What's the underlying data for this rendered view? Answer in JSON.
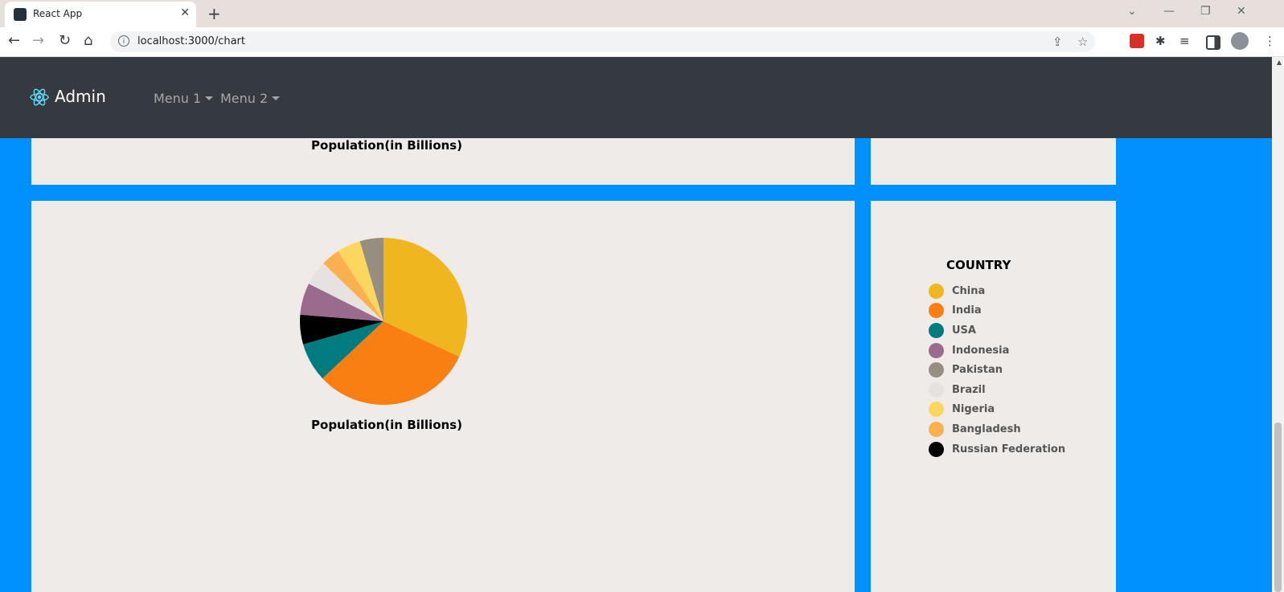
{
  "browser": {
    "tab_title": "React App",
    "tab_close": "✕",
    "new_tab": "+",
    "url": "localhost:3000/chart",
    "window_controls": [
      "⌄",
      "—",
      "❐",
      "✕"
    ]
  },
  "navbar": {
    "brand": "Admin",
    "menus": [
      "Menu 1",
      "Menu 2"
    ]
  },
  "top_chart": {
    "caption": "Population(in Billions)"
  },
  "chart_data": {
    "type": "pie",
    "title": "",
    "caption": "Population(in Billions)",
    "legend_title": "COUNTRY",
    "legend_position": "right",
    "slices": [
      {
        "label": "China",
        "value": 1.4,
        "color": "#f0b620"
      },
      {
        "label": "India",
        "value": 1.36,
        "color": "#f97f13"
      },
      {
        "label": "USA",
        "value": 0.33,
        "color": "#027b7f"
      },
      {
        "label": "Russian Federation",
        "value": 0.25,
        "color": "#000000"
      },
      {
        "label": "Indonesia",
        "value": 0.27,
        "color": "#9a6b8c"
      },
      {
        "label": "Brazil",
        "value": 0.21,
        "color": "#e5e2df"
      },
      {
        "label": "Bangladesh",
        "value": 0.16,
        "color": "#fbb050"
      },
      {
        "label": "Nigeria",
        "value": 0.2,
        "color": "#fcd75f"
      },
      {
        "label": "Pakistan",
        "value": 0.2,
        "color": "#988e80"
      }
    ],
    "legend": [
      {
        "label": "China",
        "color": "#f0b620"
      },
      {
        "label": "India",
        "color": "#f97f13"
      },
      {
        "label": "USA",
        "color": "#027b7f"
      },
      {
        "label": "Indonesia",
        "color": "#9a6b8c"
      },
      {
        "label": "Pakistan",
        "color": "#988e80"
      },
      {
        "label": "Brazil",
        "color": "#e5e2df"
      },
      {
        "label": "Nigeria",
        "color": "#fcd75f"
      },
      {
        "label": "Bangladesh",
        "color": "#fbb050"
      },
      {
        "label": "Russian Federation",
        "color": "#000000"
      }
    ]
  },
  "colors": {
    "page_bg": "#0090ff",
    "card_bg": "#efebe8",
    "navbar_bg": "#343a40"
  }
}
